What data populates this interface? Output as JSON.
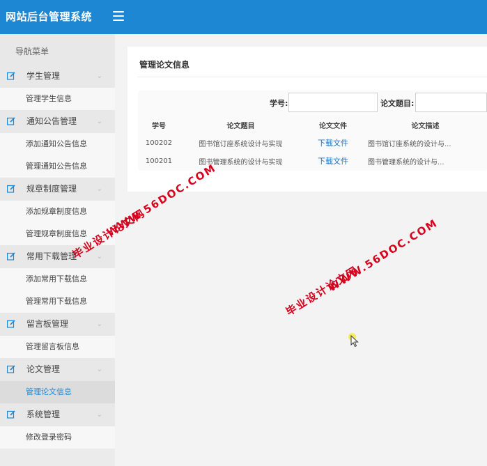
{
  "header": {
    "title": "网站后台管理系统",
    "menu_icon": "hamburger-menu-icon"
  },
  "sidebar": {
    "title": "导航菜单",
    "groups": [
      {
        "label": "学生管理",
        "items": [
          "管理学生信息"
        ]
      },
      {
        "label": "通知公告管理",
        "items": [
          "添加通知公告信息",
          "管理通知公告信息"
        ]
      },
      {
        "label": "规章制度管理",
        "items": [
          "添加规章制度信息",
          "管理规章制度信息"
        ]
      },
      {
        "label": "常用下载管理",
        "items": [
          "添加常用下载信息",
          "管理常用下载信息"
        ]
      },
      {
        "label": "留言板管理",
        "items": [
          "管理留言板信息"
        ]
      },
      {
        "label": "论文管理",
        "items": [
          "管理论文信息"
        ]
      },
      {
        "label": "系统管理",
        "items": [
          "修改登录密码"
        ]
      }
    ],
    "active_item": "管理论文信息"
  },
  "main": {
    "title": "管理论文信息",
    "search": {
      "student_id_label": "学号:",
      "student_id_value": "",
      "thesis_title_label": "论文题目:",
      "thesis_title_value": ""
    },
    "table": {
      "headers": [
        "学号",
        "论文题目",
        "论文文件",
        "论文描述"
      ],
      "rows": [
        [
          "100202",
          "图书馆订座系统设计与实现",
          "下载文件",
          "图书馆订座系统的设计与..."
        ],
        [
          "100201",
          "图书管理系统的设计与实现",
          "下载文件",
          "图书管理系统的设计与..."
        ]
      ]
    }
  },
  "watermarks": [
    "毕业设计论文网",
    "WWW.56DOC.COM"
  ],
  "colors": {
    "header": "#1e87d4",
    "link": "#1e72c0",
    "watermark": "#d8001c"
  }
}
